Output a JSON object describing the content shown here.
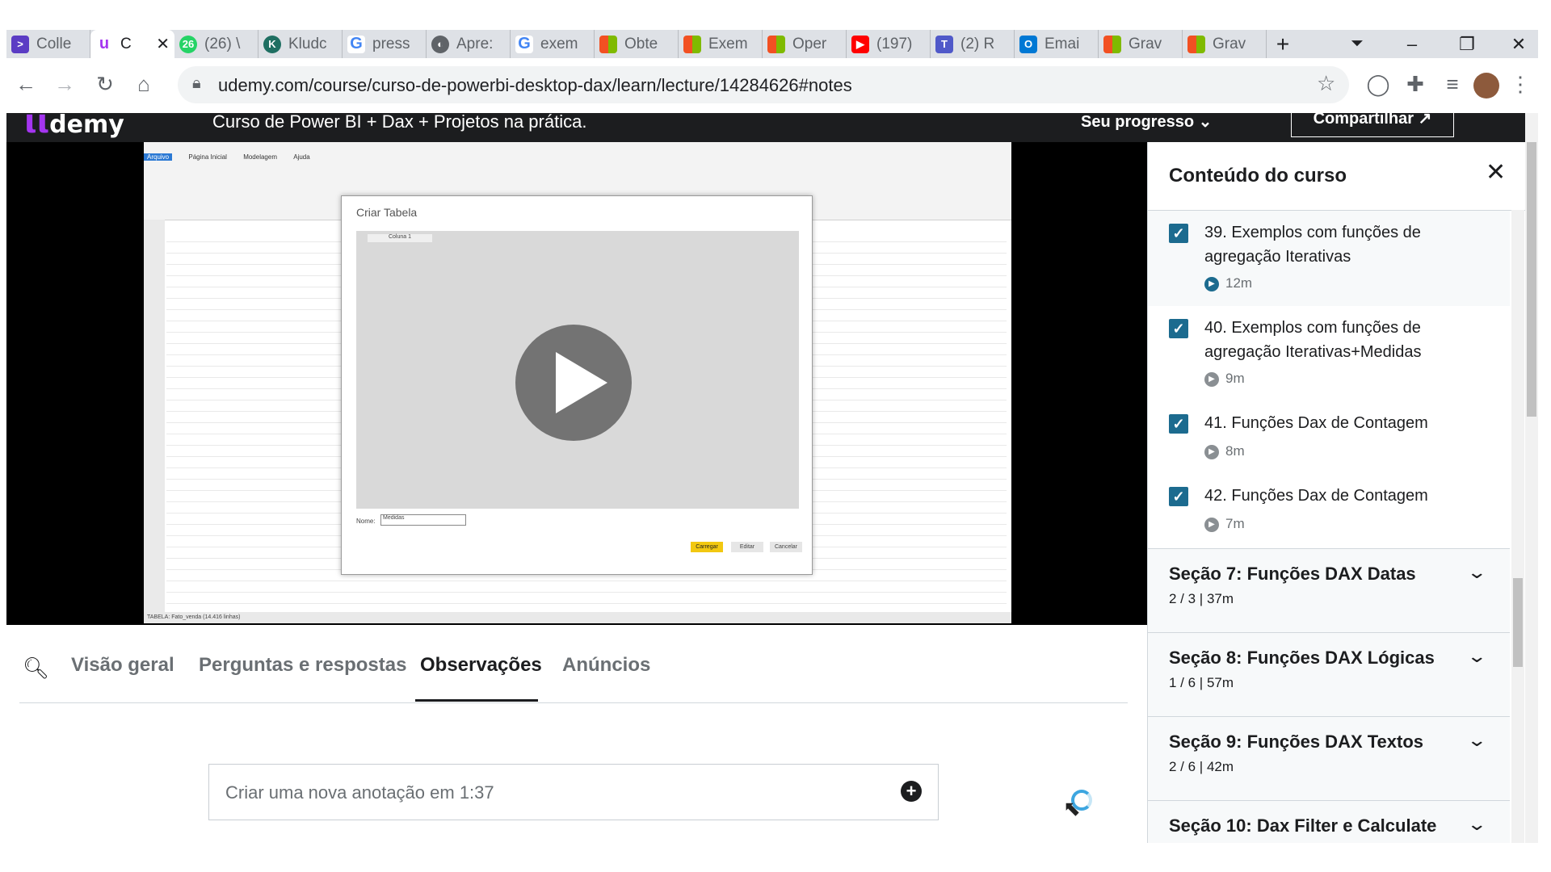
{
  "browser": {
    "tabs": [
      {
        "label": "Colle",
        "icon": "purple-chevron-icon",
        "color": "#5b3cc4"
      },
      {
        "label": "C",
        "icon": "udemy-icon",
        "color": "#a435f0",
        "active": true
      },
      {
        "label": "(26) \\",
        "icon": "whatsapp-icon",
        "color": "#25d366"
      },
      {
        "label": "Kludc",
        "icon": "kludc-icon",
        "color": "#1f6f62"
      },
      {
        "label": "press",
        "icon": "google-icon",
        "color": "#4285f4"
      },
      {
        "label": "Apre:",
        "icon": "globe-icon",
        "color": "#5f6368"
      },
      {
        "label": "exem",
        "icon": "google-icon",
        "color": "#4285f4"
      },
      {
        "label": "Obte",
        "icon": "microsoft-icon",
        "color": "#f25022"
      },
      {
        "label": "Exem",
        "icon": "microsoft-icon",
        "color": "#f25022"
      },
      {
        "label": "Oper",
        "icon": "microsoft-icon",
        "color": "#f25022"
      },
      {
        "label": "(197)",
        "icon": "youtube-icon",
        "color": "#ff0000"
      },
      {
        "label": "(2) R",
        "icon": "teams-icon",
        "color": "#5059c9"
      },
      {
        "label": "Emai",
        "icon": "outlook-icon",
        "color": "#0078d4"
      },
      {
        "label": "Grav",
        "icon": "microsoft-icon",
        "color": "#f25022"
      },
      {
        "label": "Grav",
        "icon": "microsoft-icon",
        "color": "#f25022"
      }
    ],
    "new_tab": "+",
    "url": "udemy.com/course/curso-de-powerbi-desktop-dax/learn/lecture/14284626#notes"
  },
  "udemy": {
    "logo": "ιι",
    "logo_word": "demy",
    "course_title": "Curso de Power BI + Dax + Projetos na prática.",
    "progress_label": "Seu progresso",
    "share_label": "Compartilhar"
  },
  "video": {
    "dialog_title": "Criar Tabela",
    "column_header": "Coluna 1",
    "name_label": "Nome:",
    "name_value": "Medidas",
    "btn_load": "Carregar",
    "btn_edit": "Editar",
    "btn_cancel": "Cancelar",
    "status": "TABELA: Fato_venda (14.416 linhas)",
    "menu": [
      "Arquivo",
      "Página Inicial",
      "Modelagem",
      "Ajuda"
    ]
  },
  "sidebar": {
    "title": "Conteúdo do curso",
    "lectures": [
      {
        "title": "39. Exemplos com funções de agregação Iterativas",
        "duration": "12m",
        "active": true
      },
      {
        "title": "40. Exemplos com funções de agregação Iterativas+Medidas",
        "duration": "9m"
      },
      {
        "title": "41. Funções Dax de Contagem",
        "duration": "8m"
      },
      {
        "title": "42. Funções Dax de Contagem",
        "duration": "7m"
      }
    ],
    "sections": [
      {
        "title": "Seção 7: Funções DAX Datas",
        "sub": "2 / 3 | 37m"
      },
      {
        "title": "Seção 8: Funções DAX Lógicas",
        "sub": "1 / 6 | 57m"
      },
      {
        "title": "Seção 9: Funções DAX Textos",
        "sub": "2 / 6 | 42m"
      },
      {
        "title": "Seção 10: Dax Filter e Calculate",
        "sub": ""
      }
    ]
  },
  "content_tabs": [
    "Visão geral",
    "Perguntas e respostas",
    "Observações",
    "Anúncios"
  ],
  "note": {
    "placeholder": "Criar uma nova anotação em 1:37"
  }
}
